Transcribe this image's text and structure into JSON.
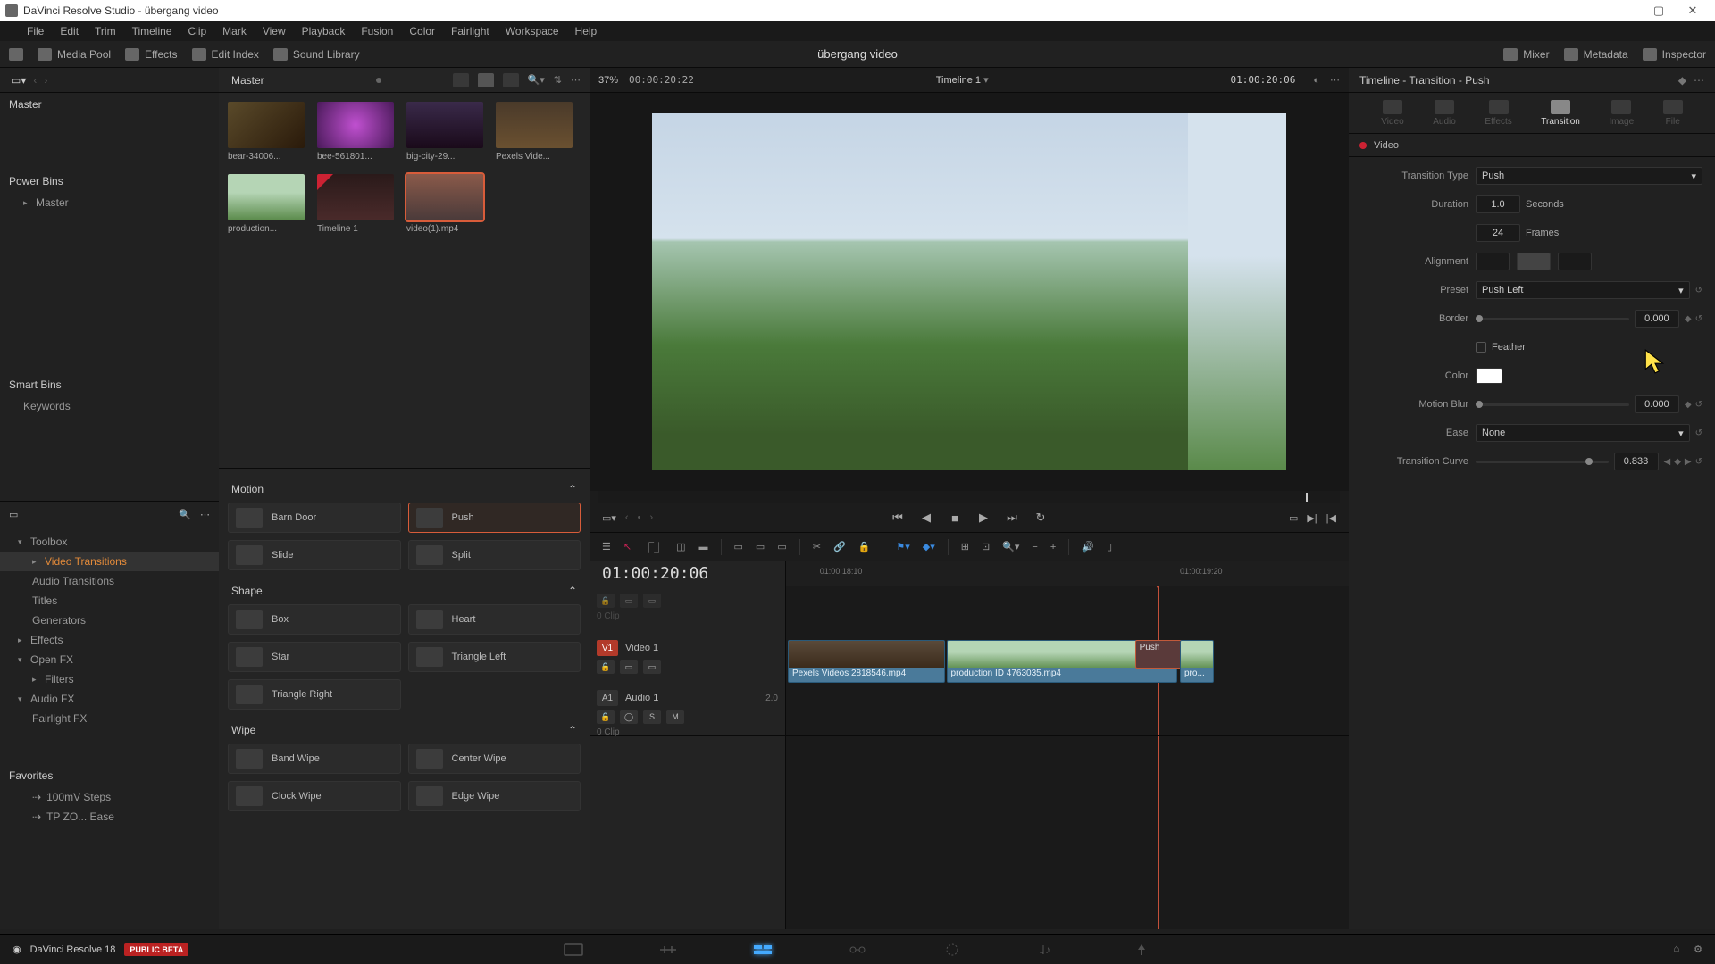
{
  "window": {
    "title": "DaVinci Resolve Studio - übergang video"
  },
  "menubar": [
    "File",
    "Edit",
    "Trim",
    "Timeline",
    "Clip",
    "Mark",
    "View",
    "Playback",
    "Fusion",
    "Color",
    "Fairlight",
    "Workspace",
    "Help"
  ],
  "toptool": {
    "left": [
      {
        "icon": "screen-icon",
        "label": ""
      },
      {
        "icon": "media-icon",
        "label": "Media Pool"
      },
      {
        "icon": "effects-icon",
        "label": "Effects"
      },
      {
        "icon": "index-icon",
        "label": "Edit Index"
      },
      {
        "icon": "sound-icon",
        "label": "Sound Library"
      }
    ],
    "center_title": "übergang video",
    "right": [
      {
        "icon": "mixer-icon",
        "label": "Mixer"
      },
      {
        "icon": "meta-icon",
        "label": "Metadata"
      },
      {
        "icon": "insp-icon",
        "label": "Inspector"
      }
    ]
  },
  "bins": {
    "header_label": "Master",
    "root": "Master",
    "power_title": "Power Bins",
    "power_items": [
      "Master"
    ],
    "smart_title": "Smart Bins",
    "smart_items": [
      "Keywords"
    ]
  },
  "fxtree": {
    "items": [
      {
        "label": "Toolbox",
        "expand": true
      },
      {
        "label": "Video Transitions",
        "sub": true,
        "sel": true
      },
      {
        "label": "Audio Transitions",
        "sub": true
      },
      {
        "label": "Titles",
        "sub": true
      },
      {
        "label": "Generators",
        "sub": true
      },
      {
        "label": "Effects",
        "expand": true
      },
      {
        "label": "Open FX",
        "expand": true
      },
      {
        "label": "Filters",
        "sub": true
      },
      {
        "label": "Audio FX",
        "expand": true
      },
      {
        "label": "Fairlight FX",
        "sub": true
      }
    ],
    "fav_title": "Favorites",
    "favs": [
      "100mV Steps",
      "TP ZO... Ease"
    ]
  },
  "pool": {
    "header_pct": "37%",
    "header_tc": "00:00:20:22",
    "clips": [
      {
        "name": "bear-34006...",
        "art": "art-bear"
      },
      {
        "name": "bee-561801...",
        "art": "art-bee"
      },
      {
        "name": "big-city-29...",
        "art": "art-city"
      },
      {
        "name": "Pexels Vide...",
        "art": "art-pexels"
      },
      {
        "name": "production...",
        "art": "art-prod"
      },
      {
        "name": "Timeline 1",
        "art": "art-tl",
        "badge": true
      },
      {
        "name": "video(1).mp4",
        "art": "art-vid1",
        "sel": true
      }
    ]
  },
  "trans": {
    "cats": [
      {
        "name": "Motion",
        "items": [
          {
            "name": "Barn Door"
          },
          {
            "name": "Push",
            "sel": true
          },
          {
            "name": "Slide"
          },
          {
            "name": "Split"
          }
        ]
      },
      {
        "name": "Shape",
        "items": [
          {
            "name": "Box"
          },
          {
            "name": "Heart"
          },
          {
            "name": "Star"
          },
          {
            "name": "Triangle Left"
          },
          {
            "name": "Triangle Right"
          }
        ]
      },
      {
        "name": "Wipe",
        "items": [
          {
            "name": "Band Wipe"
          },
          {
            "name": "Center Wipe"
          },
          {
            "name": "Clock Wipe"
          },
          {
            "name": "Edge Wipe"
          }
        ]
      }
    ]
  },
  "viewer": {
    "header_tl": "Timeline 1",
    "header_tc_left": "00:00:20:22",
    "header_tc_right": "01:00:20:06",
    "zoom": "37%"
  },
  "timeline": {
    "tc": "01:00:20:06",
    "ruler": [
      "01:00:18:10",
      "01:00:19:20"
    ],
    "tracks": {
      "v2": {
        "label": "",
        "sub": "0 Clip"
      },
      "v1": {
        "badge": "V1",
        "label": "Video 1"
      },
      "a1": {
        "badge": "A1",
        "label": "Audio 1",
        "meta": "2.0",
        "sub": "0 Clip"
      }
    },
    "clips": {
      "c1": "Pexels Videos 2818546.mp4",
      "c2": "production ID 4763035.mp4",
      "c3": "pro...",
      "trans": "Push"
    }
  },
  "inspector": {
    "header": "Timeline - Transition - Push",
    "tabs": [
      "Video",
      "Audio",
      "Effects",
      "Transition",
      "Image",
      "File"
    ],
    "active_tab": 3,
    "section": "Video",
    "props": {
      "transition_type_lbl": "Transition Type",
      "transition_type_val": "Push",
      "duration_lbl": "Duration",
      "duration_sec": "1.0",
      "seconds": "Seconds",
      "duration_frm": "24",
      "frames": "Frames",
      "alignment_lbl": "Alignment",
      "preset_lbl": "Preset",
      "preset_val": "Push Left",
      "border_lbl": "Border",
      "border_val": "0.000",
      "feather_lbl": "Feather",
      "color_lbl": "Color",
      "motion_blur_lbl": "Motion Blur",
      "motion_blur_val": "0.000",
      "ease_lbl": "Ease",
      "ease_val": "None",
      "curve_lbl": "Transition Curve",
      "curve_val": "0.833"
    }
  },
  "footer": {
    "app": "DaVinci Resolve 18",
    "badge": "PUBLIC BETA"
  }
}
